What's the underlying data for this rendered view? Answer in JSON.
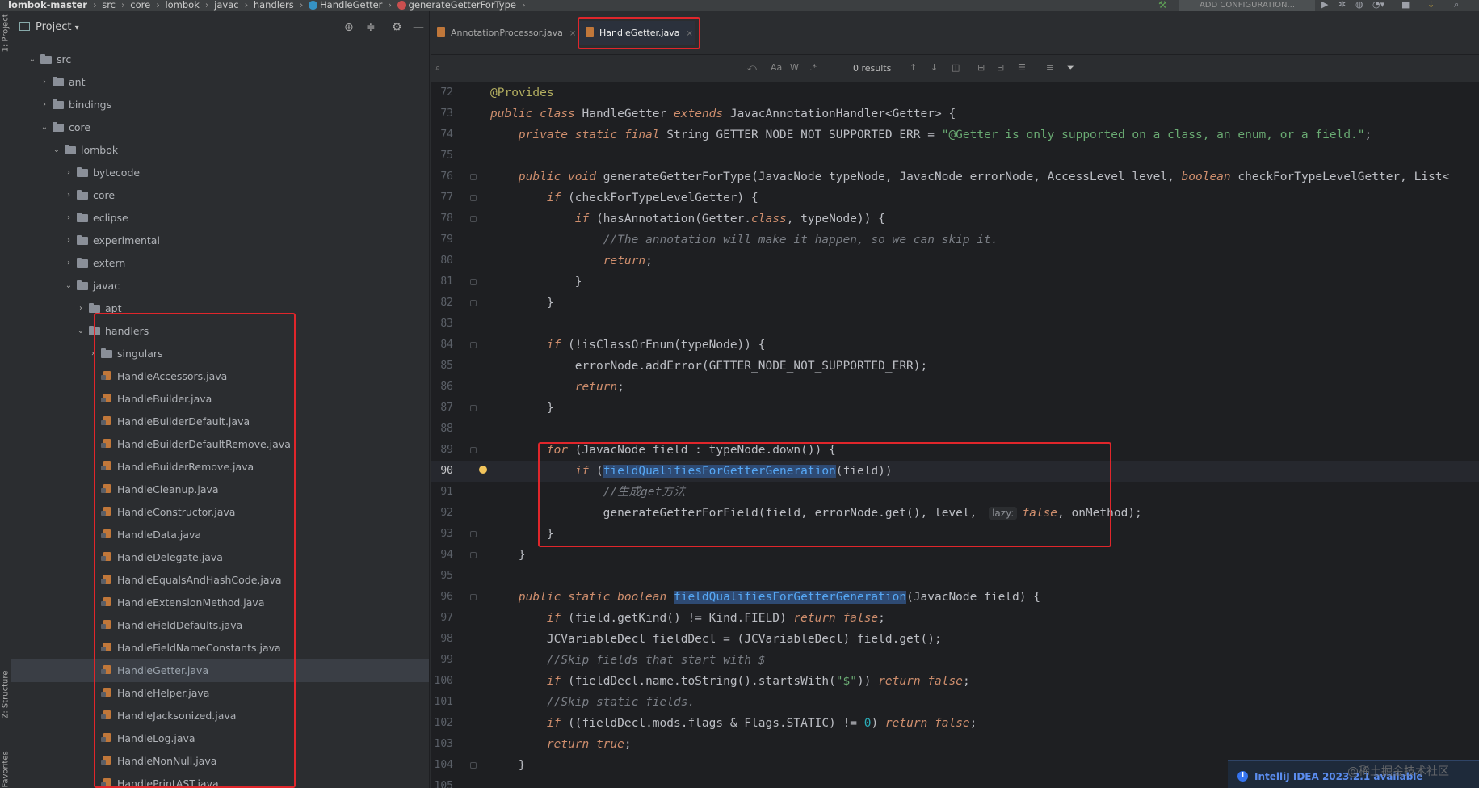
{
  "breadcrumbs": {
    "project": "lombok-master",
    "items": [
      "src",
      "core",
      "lombok",
      "javac",
      "handlers"
    ],
    "class": "HandleGetter",
    "method": "generateGetterForType"
  },
  "toolbar": {
    "add_config_label": "ADD CONFIGURATION..."
  },
  "left_strip": {
    "project_label": "1: Project",
    "structure_label": "Z: Structure",
    "favorites_label": "Favorites"
  },
  "project_panel": {
    "title": "Project",
    "tree": [
      {
        "label": "src",
        "kind": "folder",
        "depth": 0,
        "expanded": true
      },
      {
        "label": "ant",
        "kind": "folder",
        "depth": 1,
        "expanded": false
      },
      {
        "label": "bindings",
        "kind": "folder",
        "depth": 1,
        "expanded": false
      },
      {
        "label": "core",
        "kind": "folder",
        "depth": 1,
        "expanded": true
      },
      {
        "label": "lombok",
        "kind": "folder",
        "depth": 2,
        "expanded": true
      },
      {
        "label": "bytecode",
        "kind": "folder",
        "depth": 3,
        "expanded": false
      },
      {
        "label": "core",
        "kind": "folder",
        "depth": 3,
        "expanded": false
      },
      {
        "label": "eclipse",
        "kind": "folder",
        "depth": 3,
        "expanded": false
      },
      {
        "label": "experimental",
        "kind": "folder",
        "depth": 3,
        "expanded": false
      },
      {
        "label": "extern",
        "kind": "folder",
        "depth": 3,
        "expanded": false
      },
      {
        "label": "javac",
        "kind": "folder",
        "depth": 3,
        "expanded": true
      },
      {
        "label": "apt",
        "kind": "folder",
        "depth": 4,
        "expanded": false
      },
      {
        "label": "handlers",
        "kind": "folder",
        "depth": 4,
        "expanded": true
      },
      {
        "label": "singulars",
        "kind": "folder",
        "depth": 5,
        "expanded": false
      },
      {
        "label": "HandleAccessors.java",
        "kind": "file",
        "depth": 5
      },
      {
        "label": "HandleBuilder.java",
        "kind": "file",
        "depth": 5
      },
      {
        "label": "HandleBuilderDefault.java",
        "kind": "file",
        "depth": 5
      },
      {
        "label": "HandleBuilderDefaultRemove.java",
        "kind": "file",
        "depth": 5
      },
      {
        "label": "HandleBuilderRemove.java",
        "kind": "file",
        "depth": 5
      },
      {
        "label": "HandleCleanup.java",
        "kind": "file",
        "depth": 5
      },
      {
        "label": "HandleConstructor.java",
        "kind": "file",
        "depth": 5
      },
      {
        "label": "HandleData.java",
        "kind": "file",
        "depth": 5
      },
      {
        "label": "HandleDelegate.java",
        "kind": "file",
        "depth": 5
      },
      {
        "label": "HandleEqualsAndHashCode.java",
        "kind": "file",
        "depth": 5
      },
      {
        "label": "HandleExtensionMethod.java",
        "kind": "file",
        "depth": 5
      },
      {
        "label": "HandleFieldDefaults.java",
        "kind": "file",
        "depth": 5
      },
      {
        "label": "HandleFieldNameConstants.java",
        "kind": "file",
        "depth": 5
      },
      {
        "label": "HandleGetter.java",
        "kind": "file",
        "depth": 5,
        "selected": true
      },
      {
        "label": "HandleHelper.java",
        "kind": "file",
        "depth": 5
      },
      {
        "label": "HandleJacksonized.java",
        "kind": "file",
        "depth": 5
      },
      {
        "label": "HandleLog.java",
        "kind": "file",
        "depth": 5
      },
      {
        "label": "HandleNonNull.java",
        "kind": "file",
        "depth": 5
      },
      {
        "label": "HandlePrintAST.java",
        "kind": "file",
        "depth": 5
      }
    ]
  },
  "tabs": [
    {
      "label": "AnnotationProcessor.java",
      "active": false
    },
    {
      "label": "HandleGetter.java",
      "active": true
    }
  ],
  "search": {
    "results": "0 results",
    "opt_case": "Aa",
    "opt_word": "W",
    "opt_regex": ".*"
  },
  "current_line": "90",
  "code_lines": [
    {
      "n": "72",
      "tokens": [
        [
          "ann",
          "@Provides"
        ]
      ]
    },
    {
      "n": "73",
      "tokens": [
        [
          "kw",
          "public class "
        ],
        [
          "",
          "HandleGetter "
        ],
        [
          "kw",
          "extends "
        ],
        [
          "",
          "JavacAnnotationHandler<Getter> {"
        ]
      ]
    },
    {
      "n": "74",
      "tokens": [
        [
          "",
          "    "
        ],
        [
          "kw",
          "private static final "
        ],
        [
          "",
          "String GETTER_NODE_NOT_SUPPORTED_ERR = "
        ],
        [
          "str",
          "\"@Getter is only supported on a class, an enum, or a field.\""
        ],
        [
          "",
          ";"
        ]
      ]
    },
    {
      "n": "75",
      "tokens": []
    },
    {
      "n": "76",
      "tokens": [
        [
          "",
          "    "
        ],
        [
          "kw",
          "public void "
        ],
        [
          "",
          "generateGetterForType(JavacNode typeNode, JavacNode errorNode, AccessLevel level, "
        ],
        [
          "kw",
          "boolean "
        ],
        [
          "",
          "checkForTypeLevelGetter, List<"
        ]
      ]
    },
    {
      "n": "77",
      "tokens": [
        [
          "",
          "        "
        ],
        [
          "kw",
          "if "
        ],
        [
          "",
          "(checkForTypeLevelGetter) {"
        ]
      ]
    },
    {
      "n": "78",
      "tokens": [
        [
          "",
          "            "
        ],
        [
          "kw",
          "if "
        ],
        [
          "",
          "(hasAnnotation(Getter."
        ],
        [
          "kw",
          "class"
        ],
        [
          "",
          ", typeNode)) {"
        ]
      ]
    },
    {
      "n": "79",
      "tokens": [
        [
          "",
          "                "
        ],
        [
          "cm",
          "//The annotation will make it happen, so we can skip it."
        ]
      ]
    },
    {
      "n": "80",
      "tokens": [
        [
          "",
          "                "
        ],
        [
          "kw",
          "return"
        ],
        [
          "",
          ";"
        ]
      ]
    },
    {
      "n": "81",
      "tokens": [
        [
          "",
          "            }"
        ]
      ]
    },
    {
      "n": "82",
      "tokens": [
        [
          "",
          "        }"
        ]
      ]
    },
    {
      "n": "83",
      "tokens": []
    },
    {
      "n": "84",
      "tokens": [
        [
          "",
          "        "
        ],
        [
          "kw",
          "if "
        ],
        [
          "",
          "(!isClassOrEnum(typeNode)) {"
        ]
      ]
    },
    {
      "n": "85",
      "tokens": [
        [
          "",
          "            errorNode.addError(GETTER_NODE_NOT_SUPPORTED_ERR);"
        ]
      ]
    },
    {
      "n": "86",
      "tokens": [
        [
          "",
          "            "
        ],
        [
          "kw",
          "return"
        ],
        [
          "",
          ";"
        ]
      ]
    },
    {
      "n": "87",
      "tokens": [
        [
          "",
          "        }"
        ]
      ]
    },
    {
      "n": "88",
      "tokens": []
    },
    {
      "n": "89",
      "tokens": [
        [
          "",
          "        "
        ],
        [
          "kw",
          "for "
        ],
        [
          "",
          "(JavacNode field : typeNode.down()) {"
        ]
      ]
    },
    {
      "n": "90",
      "tokens": [
        [
          "",
          "            "
        ],
        [
          "kw",
          "if "
        ],
        [
          "",
          "("
        ],
        [
          "hlsym",
          "fieldQualifiesForGetterGeneration"
        ],
        [
          "",
          "(field))"
        ]
      ]
    },
    {
      "n": "91",
      "tokens": [
        [
          "",
          "                "
        ],
        [
          "cm",
          "//生成get方法"
        ]
      ]
    },
    {
      "n": "92",
      "tokens": [
        [
          "",
          "                generateGetterForField(field, errorNode.get(), level, "
        ],
        [
          "hint",
          "lazy:"
        ],
        [
          "kw",
          "false"
        ],
        [
          "",
          ", onMethod);"
        ]
      ]
    },
    {
      "n": "93",
      "tokens": [
        [
          "",
          "        }"
        ]
      ]
    },
    {
      "n": "94",
      "tokens": [
        [
          "",
          "    }"
        ]
      ]
    },
    {
      "n": "95",
      "tokens": []
    },
    {
      "n": "96",
      "tokens": [
        [
          "",
          "    "
        ],
        [
          "kw",
          "public static boolean "
        ],
        [
          "hlsym",
          "fieldQualifiesForGetterGeneration"
        ],
        [
          "",
          "(JavacNode field) {"
        ]
      ]
    },
    {
      "n": "97",
      "tokens": [
        [
          "",
          "        "
        ],
        [
          "kw",
          "if "
        ],
        [
          "",
          "(field.getKind() != Kind.FIELD) "
        ],
        [
          "kw",
          "return false"
        ],
        [
          "",
          ";"
        ]
      ]
    },
    {
      "n": "98",
      "tokens": [
        [
          "",
          "        JCVariableDecl fieldDecl = (JCVariableDecl) field.get();"
        ]
      ]
    },
    {
      "n": "99",
      "tokens": [
        [
          "",
          "        "
        ],
        [
          "cm",
          "//Skip fields that start with $"
        ]
      ]
    },
    {
      "n": "100",
      "tokens": [
        [
          "",
          "        "
        ],
        [
          "kw",
          "if "
        ],
        [
          "",
          "(fieldDecl.name.toString().startsWith("
        ],
        [
          "str",
          "\"$\""
        ],
        [
          "",
          ")) "
        ],
        [
          "kw",
          "return false"
        ],
        [
          "",
          ";"
        ]
      ]
    },
    {
      "n": "101",
      "tokens": [
        [
          "",
          "        "
        ],
        [
          "cm",
          "//Skip static fields."
        ]
      ]
    },
    {
      "n": "102",
      "tokens": [
        [
          "",
          "        "
        ],
        [
          "kw",
          "if "
        ],
        [
          "",
          "((fieldDecl.mods.flags & Flags.STATIC) != "
        ],
        [
          "num",
          "0"
        ],
        [
          "",
          ") "
        ],
        [
          "kw",
          "return false"
        ],
        [
          "",
          ";"
        ]
      ]
    },
    {
      "n": "103",
      "tokens": [
        [
          "",
          "        "
        ],
        [
          "kw",
          "return true"
        ],
        [
          "",
          ";"
        ]
      ]
    },
    {
      "n": "104",
      "tokens": [
        [
          "",
          "    }"
        ]
      ]
    },
    {
      "n": "105",
      "tokens": []
    }
  ],
  "notification": {
    "text": "IntelliJ IDEA 2023.2.1 available"
  },
  "watermark": "@稀土掘金技术社区"
}
